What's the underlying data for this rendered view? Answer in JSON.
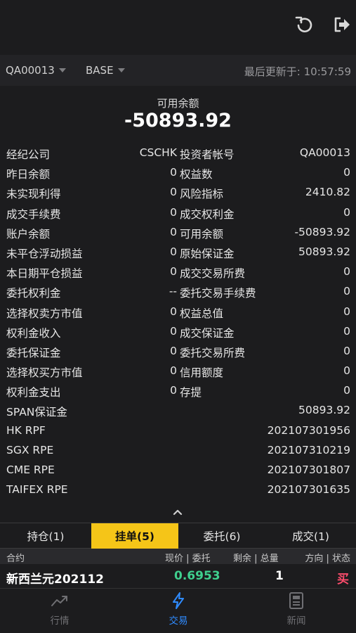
{
  "account_selector": "QA00013",
  "currency_selector": "BASE",
  "last_updated": "最后更新于: 10:57:59",
  "balance": {
    "label": "可用余额",
    "value": "-50893.92"
  },
  "rows": [
    {
      "l1": "经纪公司",
      "v1": "CSCHK",
      "l2": "投资者帐号",
      "v2": "QA00013"
    },
    {
      "l1": "昨日余额",
      "v1": "0",
      "l2": "权益数",
      "v2": "0"
    },
    {
      "l1": "未实现利得",
      "v1": "0",
      "l2": "风险指标",
      "v2": "2410.82"
    },
    {
      "l1": "成交手续费",
      "v1": "0",
      "l2": "成交权利金",
      "v2": "0"
    },
    {
      "l1": "账户余额",
      "v1": "0",
      "l2": "可用余额",
      "v2": "-50893.92"
    },
    {
      "l1": "未平仓浮动损益",
      "v1": "0",
      "l2": "原始保证金",
      "v2": "50893.92"
    },
    {
      "l1": "本日期平仓损益",
      "v1": "0",
      "l2": "成交交易所费",
      "v2": "0"
    },
    {
      "l1": "委托权利金",
      "v1": "--",
      "l2": "委托交易手续费",
      "v2": "0"
    },
    {
      "l1": "选择权卖方市值",
      "v1": "0",
      "l2": "权益总值",
      "v2": "0"
    },
    {
      "l1": "权利金收入",
      "v1": "0",
      "l2": "成交保证金",
      "v2": "0"
    },
    {
      "l1": "委托保证金",
      "v1": "0",
      "l2": "委托交易所费",
      "v2": "0"
    },
    {
      "l1": "选择权买方市值",
      "v1": "0",
      "l2": "信用额度",
      "v2": "0"
    },
    {
      "l1": "权利金支出",
      "v1": "0",
      "l2": "存提",
      "v2": "0"
    },
    {
      "l1": "SPAN保证金",
      "v1": "",
      "l2": "",
      "v2": "50893.92"
    },
    {
      "l1": "HK RPF",
      "v1": "",
      "l2": "",
      "v2": "202107301956"
    },
    {
      "l1": "SGX RPE",
      "v1": "",
      "l2": "",
      "v2": "202107310219"
    },
    {
      "l1": "CME RPE",
      "v1": "",
      "l2": "",
      "v2": "202107301807"
    },
    {
      "l1": "TAIFEX RPE",
      "v1": "",
      "l2": "",
      "v2": "202107301635"
    }
  ],
  "tabs": [
    {
      "label": "持仓(1)"
    },
    {
      "label": "挂单(5)"
    },
    {
      "label": "委托(6)"
    },
    {
      "label": "成交(1)"
    }
  ],
  "table_header": {
    "contract": "合约",
    "price": "现价 | 委托",
    "qty": "剩余 | 总量",
    "dir": "方向 | 状态"
  },
  "order": {
    "name": "新西兰元202112",
    "price": "0.6953",
    "qty": "1",
    "dir": "买"
  },
  "nav": [
    {
      "label": "行情"
    },
    {
      "label": "交易"
    },
    {
      "label": "新闻"
    }
  ],
  "colors": {
    "accent": "#f5c518",
    "nav_active": "#2f8bff",
    "price_up": "#3fcf8e",
    "buy": "#ff4d6d"
  },
  "icons": {
    "refresh": "refresh-icon",
    "logout": "logout-icon",
    "expand": "chevron-up-icon",
    "market": "trend-line-icon",
    "trade": "lightning-icon",
    "news": "newspaper-icon"
  }
}
